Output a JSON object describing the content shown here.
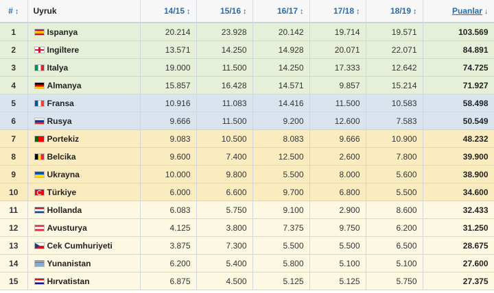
{
  "headers": {
    "rank": "#",
    "country": "Uyruk",
    "seasons": [
      "14/15",
      "15/16",
      "16/17",
      "17/18",
      "18/19"
    ],
    "points": "Puanlar"
  },
  "rows": [
    {
      "rank": "1",
      "country": "Ispanya",
      "flag": "spain-flag-icon",
      "flagClass": "f-es",
      "zone": "z-green",
      "values": [
        "20.214",
        "23.928",
        "20.142",
        "19.714",
        "19.571"
      ],
      "points": "103.569"
    },
    {
      "rank": "2",
      "country": "Ingiltere",
      "flag": "england-flag-icon",
      "flagClass": "f-gb",
      "zone": "z-green",
      "values": [
        "13.571",
        "14.250",
        "14.928",
        "20.071",
        "22.071"
      ],
      "points": "84.891"
    },
    {
      "rank": "3",
      "country": "Italya",
      "flag": "italy-flag-icon",
      "flagClass": "f-it",
      "zone": "z-green",
      "values": [
        "19.000",
        "11.500",
        "14.250",
        "17.333",
        "12.642"
      ],
      "points": "74.725"
    },
    {
      "rank": "4",
      "country": "Almanya",
      "flag": "germany-flag-icon",
      "flagClass": "f-de",
      "zone": "z-green",
      "values": [
        "15.857",
        "16.428",
        "14.571",
        "9.857",
        "15.214"
      ],
      "points": "71.927"
    },
    {
      "rank": "5",
      "country": "Fransa",
      "flag": "france-flag-icon",
      "flagClass": "f-fr",
      "zone": "z-blue",
      "values": [
        "10.916",
        "11.083",
        "14.416",
        "11.500",
        "10.583"
      ],
      "points": "58.498"
    },
    {
      "rank": "6",
      "country": "Rusya",
      "flag": "russia-flag-icon",
      "flagClass": "f-ru",
      "zone": "z-blue",
      "values": [
        "9.666",
        "11.500",
        "9.200",
        "12.600",
        "7.583"
      ],
      "points": "50.549"
    },
    {
      "rank": "7",
      "country": "Portekiz",
      "flag": "portugal-flag-icon",
      "flagClass": "f-pt",
      "zone": "z-orange",
      "values": [
        "9.083",
        "10.500",
        "8.083",
        "9.666",
        "10.900"
      ],
      "points": "48.232"
    },
    {
      "rank": "8",
      "country": "Belcika",
      "flag": "belgium-flag-icon",
      "flagClass": "f-be",
      "zone": "z-orange",
      "values": [
        "9.600",
        "7.400",
        "12.500",
        "2.600",
        "7.800"
      ],
      "points": "39.900"
    },
    {
      "rank": "9",
      "country": "Ukrayna",
      "flag": "ukraine-flag-icon",
      "flagClass": "f-ua",
      "zone": "z-orange",
      "values": [
        "10.000",
        "9.800",
        "5.500",
        "8.000",
        "5.600"
      ],
      "points": "38.900"
    },
    {
      "rank": "10",
      "country": "Türkiye",
      "flag": "turkey-flag-icon",
      "flagClass": "f-tr",
      "zone": "z-orange",
      "values": [
        "6.000",
        "6.600",
        "9.700",
        "6.800",
        "5.500"
      ],
      "points": "34.600"
    },
    {
      "rank": "11",
      "country": "Hollanda",
      "flag": "netherlands-flag-icon",
      "flagClass": "f-nl",
      "zone": "z-yellow",
      "values": [
        "6.083",
        "5.750",
        "9.100",
        "2.900",
        "8.600"
      ],
      "points": "32.433"
    },
    {
      "rank": "12",
      "country": "Avusturya",
      "flag": "austria-flag-icon",
      "flagClass": "f-at",
      "zone": "z-yellow",
      "values": [
        "4.125",
        "3.800",
        "7.375",
        "9.750",
        "6.200"
      ],
      "points": "31.250"
    },
    {
      "rank": "13",
      "country": "Cek Cumhuriyeti",
      "flag": "czech-flag-icon",
      "flagClass": "f-cz",
      "zone": "z-yellow",
      "values": [
        "3.875",
        "7.300",
        "5.500",
        "5.500",
        "6.500"
      ],
      "points": "28.675"
    },
    {
      "rank": "14",
      "country": "Yunanistan",
      "flag": "greece-flag-icon",
      "flagClass": "f-gr",
      "zone": "z-yellow",
      "values": [
        "6.200",
        "5.400",
        "5.800",
        "5.100",
        "5.100"
      ],
      "points": "27.600"
    },
    {
      "rank": "15",
      "country": "Hırvatistan",
      "flag": "croatia-flag-icon",
      "flagClass": "f-hr",
      "zone": "z-yellow",
      "values": [
        "6.875",
        "4.500",
        "5.125",
        "5.125",
        "5.750"
      ],
      "points": "27.375"
    }
  ]
}
